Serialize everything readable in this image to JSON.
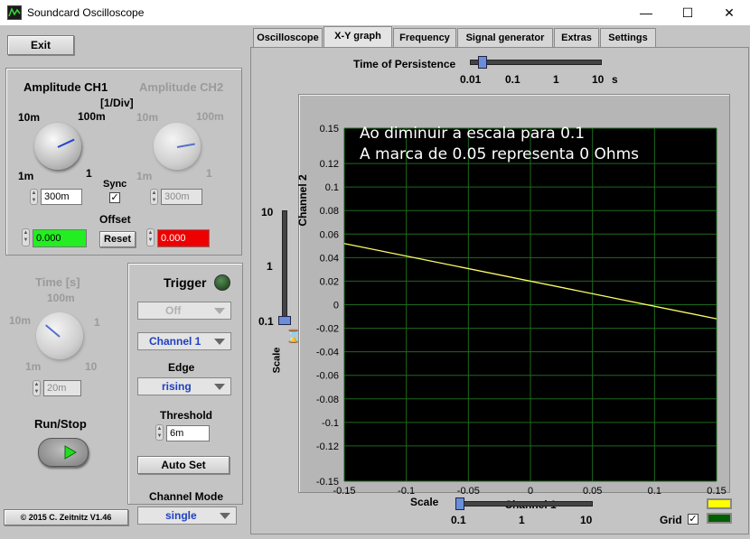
{
  "window": {
    "title": "Soundcard Oscilloscope",
    "minimize_glyph": "—",
    "maximize_glyph": "☐",
    "close_glyph": "✕"
  },
  "left": {
    "exit_label": "Exit",
    "amplitude_ch1_label": "Amplitude CH1",
    "amplitude_ch2_label": "Amplitude CH2",
    "unit_label": "[1/Div]",
    "knob_marks": {
      "tl": "10m",
      "tr": "100m",
      "bl": "1m",
      "br": "1"
    },
    "sync_label": "Sync",
    "sync_checked": "✓",
    "ch1_amp_value": "300m",
    "ch2_amp_value": "300m",
    "offset_label": "Offset",
    "offset_ch1": "0.000",
    "offset_ch2": "0.000",
    "reset_label": "Reset",
    "time_label": "Time [s]",
    "time_marks": {
      "top": "100m",
      "left": "10m",
      "right": "1",
      "bl": "1m",
      "br": "10"
    },
    "time_value": "20m",
    "run_stop_label": "Run/Stop",
    "copyright": "© 2015  C. Zeitnitz V1.46",
    "channel_mode_label": "Channel Mode",
    "channel_mode_value": "single"
  },
  "trigger": {
    "title": "Trigger",
    "mode_value": "Off",
    "channel_value": "Channel 1",
    "edge_label": "Edge",
    "edge_value": "rising",
    "threshold_label": "Threshold",
    "threshold_value": "6m",
    "autoset_label": "Auto Set"
  },
  "tabs": [
    {
      "label": "Oscilloscope"
    },
    {
      "label": "X-Y graph"
    },
    {
      "label": "Frequency"
    },
    {
      "label": "Signal generator"
    },
    {
      "label": "Extras"
    },
    {
      "label": "Settings"
    }
  ],
  "active_tab": "X-Y graph",
  "persistence": {
    "label": "Time of Persistence",
    "ticks": [
      "0.01",
      "0.1",
      "1",
      "10"
    ],
    "unit": "s",
    "value": 0.01
  },
  "scale_y": {
    "label": "Scale",
    "ticks": [
      "10",
      "1",
      "0.1"
    ],
    "value": 0.1
  },
  "scale_x": {
    "label": "Scale",
    "ticks": [
      "0.1",
      "1",
      "10"
    ],
    "value": 0.1
  },
  "grid": {
    "label": "Grid",
    "checked": "✓"
  },
  "legend_colors": {
    "ch1": "#ffff00",
    "ch2": "#006000"
  },
  "annotation": {
    "line1": "Ao diminuir a escala para 0.1",
    "line2": "A marca de 0.05 representa 0 Ohms"
  },
  "chart_data": {
    "type": "line",
    "xlabel": "Channel 1",
    "ylabel": "Channel 2",
    "xlim": [
      -0.15,
      0.15
    ],
    "ylim": [
      -0.15,
      0.15
    ],
    "x_ticks": [
      "-0.15",
      "-0.1",
      "-0.05",
      "0",
      "0.05",
      "0.1",
      "0.15"
    ],
    "y_ticks": [
      "0.15",
      "0.12",
      "0.1",
      "0.08",
      "0.06",
      "0.04",
      "0.02",
      "0",
      "-0.02",
      "-0.04",
      "-0.06",
      "-0.08",
      "-0.1",
      "-0.12",
      "-0.15"
    ],
    "grid": true,
    "line_color": "#ffff66",
    "background": "#000000",
    "grid_color": "#1e6a1e",
    "series": [
      {
        "x": [
          -0.15,
          0.15
        ],
        "y": [
          0.052,
          -0.012
        ]
      }
    ]
  }
}
